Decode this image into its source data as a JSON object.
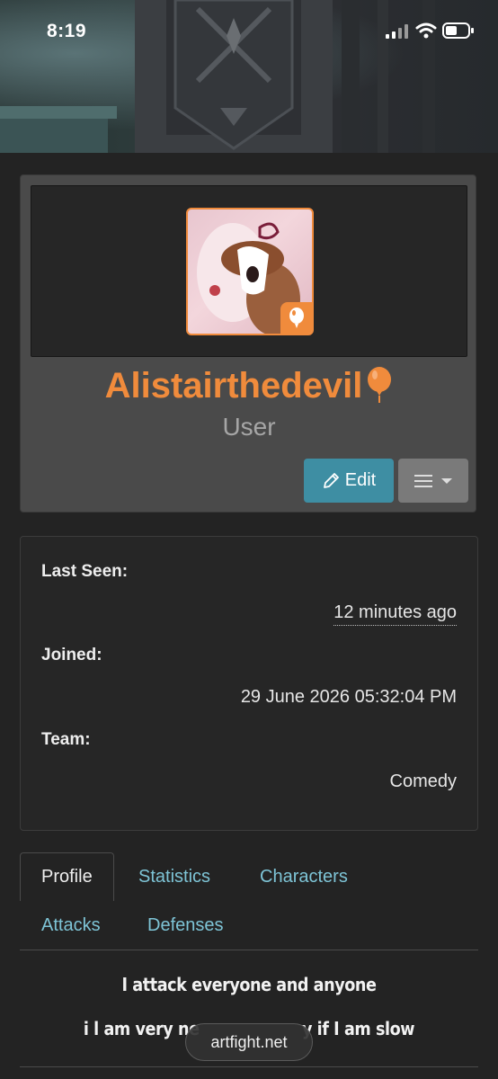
{
  "status_bar": {
    "time": "8:19"
  },
  "profile": {
    "username": "Alistairthedevil",
    "role": "User",
    "edit_label": "Edit"
  },
  "info": {
    "last_seen_label": "Last Seen:",
    "last_seen_value": "12 minutes ago",
    "joined_label": "Joined:",
    "joined_value": "29 June 2026 05:32:04 PM",
    "team_label": "Team:",
    "team_value": "Comedy"
  },
  "tabs": [
    "Profile",
    "Statistics",
    "Characters",
    "Attacks",
    "Defenses"
  ],
  "bio": {
    "line1": "I attack everyone and anyone",
    "line2_start": "i l am very ne",
    "line2_end": "y if I am slow"
  },
  "browser": {
    "url": "artfight.net"
  },
  "colors": {
    "accent": "#f08b3c",
    "link": "#7ec4d6",
    "edit_button": "#3e8ea3"
  }
}
